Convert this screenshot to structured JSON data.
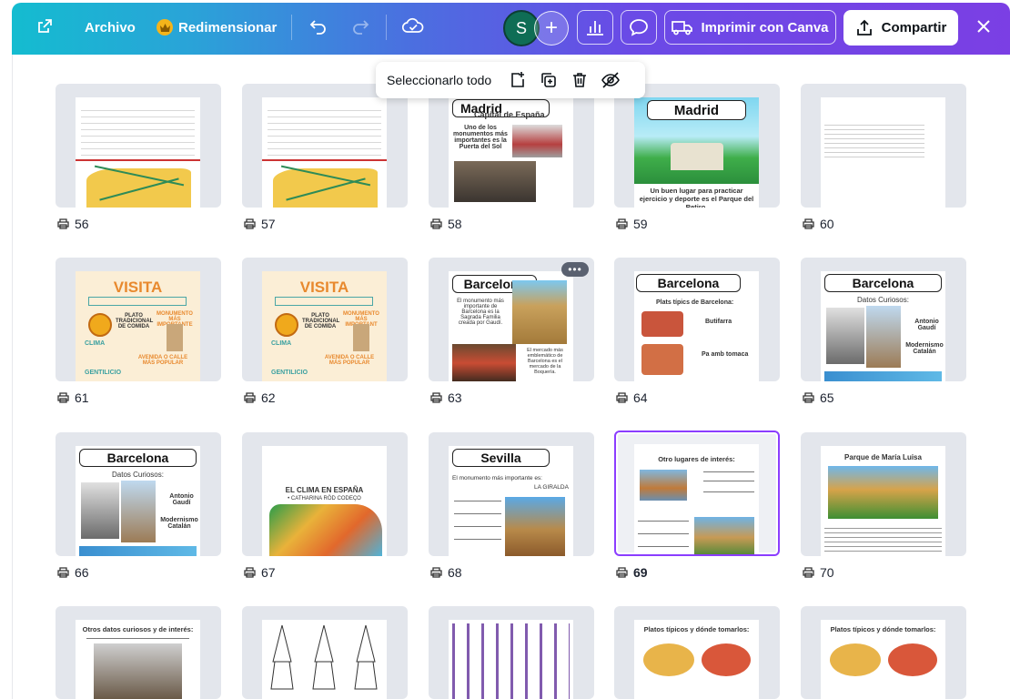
{
  "topbar": {
    "file_label": "Archivo",
    "resize_label": "Redimensionar",
    "avatar_initial": "S",
    "print_label": "Imprimir con Canva",
    "share_label": "Compartir"
  },
  "floating_toolbar": {
    "select_all_label": "Seleccionarlo todo"
  },
  "colors": {
    "accent": "#8b3dff",
    "avatar": "#0f6d55"
  },
  "pages": [
    {
      "n": "56"
    },
    {
      "n": "57"
    },
    {
      "n": "58",
      "title": "Madrid",
      "subtitle": "Capital de España",
      "caption": "Uno de los monumentos más importantes es la Puerta del Sol"
    },
    {
      "n": "59",
      "title": "Madrid",
      "caption": "Un buen lugar para practicar ejercicio y deporte es el Parque del Retiro."
    },
    {
      "n": "60"
    },
    {
      "n": "61",
      "title": "VISITA",
      "labels": [
        "PLATO TRADICIONAL DE COMIDA",
        "MONUMENTO MÁS IMPORTANTE",
        "CLIMA",
        "AVENIDA O CALLE MÁS POPULAR",
        "GENTILICIO"
      ]
    },
    {
      "n": "62",
      "title": "VISITA",
      "labels": [
        "PLATO TRADICIONAL DE COMIDA",
        "MONUMENTO MÁS IMPORTANT",
        "CLIMA",
        "AVENIDA O CALLE MÁS POPULAR",
        "GENTILICIO"
      ]
    },
    {
      "n": "63",
      "title": "Barcelona",
      "caption": "El monumento más importante de Barcelona es la Sagrada Familia creada por Gaudí.",
      "caption2": "El mercado más emblemático de Barcelona es el mercado de la Boquería."
    },
    {
      "n": "64",
      "title": "Barcelona",
      "subtitle": "Plats típics de Barcelona:",
      "items": [
        "Butifarra",
        "Pa amb tomaca"
      ]
    },
    {
      "n": "65",
      "title": "Barcelona",
      "subtitle": "Datos Curiosos:",
      "items": [
        "Antonio Gaudí",
        "Modernismo Catalán"
      ]
    },
    {
      "n": "66",
      "title": "Barcelona",
      "subtitle": "Datos Curiosos:",
      "items": [
        "Antonio Gaudí",
        "Modernismo Catalán"
      ]
    },
    {
      "n": "67",
      "title": "EL CLIMA EN ESPAÑA",
      "subtitle": "• CATHARINA RÖD CODEÇO"
    },
    {
      "n": "68",
      "title": "Sevilla",
      "caption": "El monumento más importante es:",
      "caption2": "LA GIRALDA"
    },
    {
      "n": "69",
      "title": "Otro lugares de interés:"
    },
    {
      "n": "70",
      "title": "Parque de María Luisa"
    },
    {
      "n": "",
      "title": "Otros datos curiosos y de interés:"
    },
    {
      "n": ""
    },
    {
      "n": ""
    },
    {
      "n": "",
      "title": "Platos típicos y dónde tomarlos:"
    },
    {
      "n": "",
      "title": "Platos típicos y dónde tomarlos:"
    }
  ]
}
